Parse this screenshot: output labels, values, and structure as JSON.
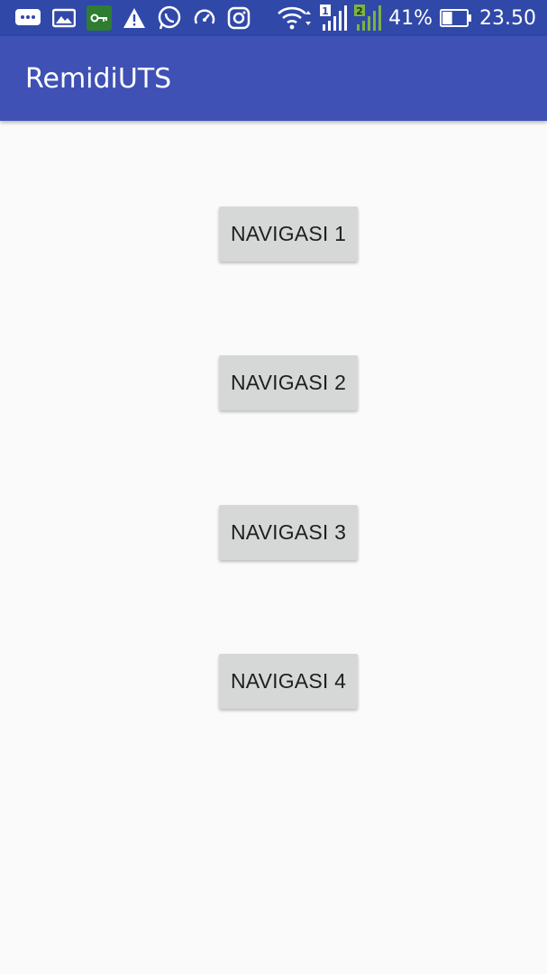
{
  "status_bar": {
    "icons": [
      "messages-icon",
      "gallery-icon",
      "vpn-key-icon",
      "warning-icon",
      "whatsapp-icon",
      "speed-icon",
      "instagram-icon",
      "wifi-icon",
      "signal-sim1-icon",
      "signal-sim2-icon",
      "battery-icon"
    ],
    "sim1_label": "1",
    "sim2_label": "2",
    "battery_percent": "41%",
    "battery_level": 0.41,
    "time": "23.50"
  },
  "app_bar": {
    "title": "RemidiUTS"
  },
  "buttons": [
    {
      "label": "NAVIGASI 1"
    },
    {
      "label": "NAVIGASI 2"
    },
    {
      "label": "NAVIGASI 3"
    },
    {
      "label": "NAVIGASI 4"
    }
  ],
  "colors": {
    "status_bar": "#3048a8",
    "app_bar": "#3f51b5",
    "background": "#fafafa",
    "button": "#d6d7d7"
  }
}
